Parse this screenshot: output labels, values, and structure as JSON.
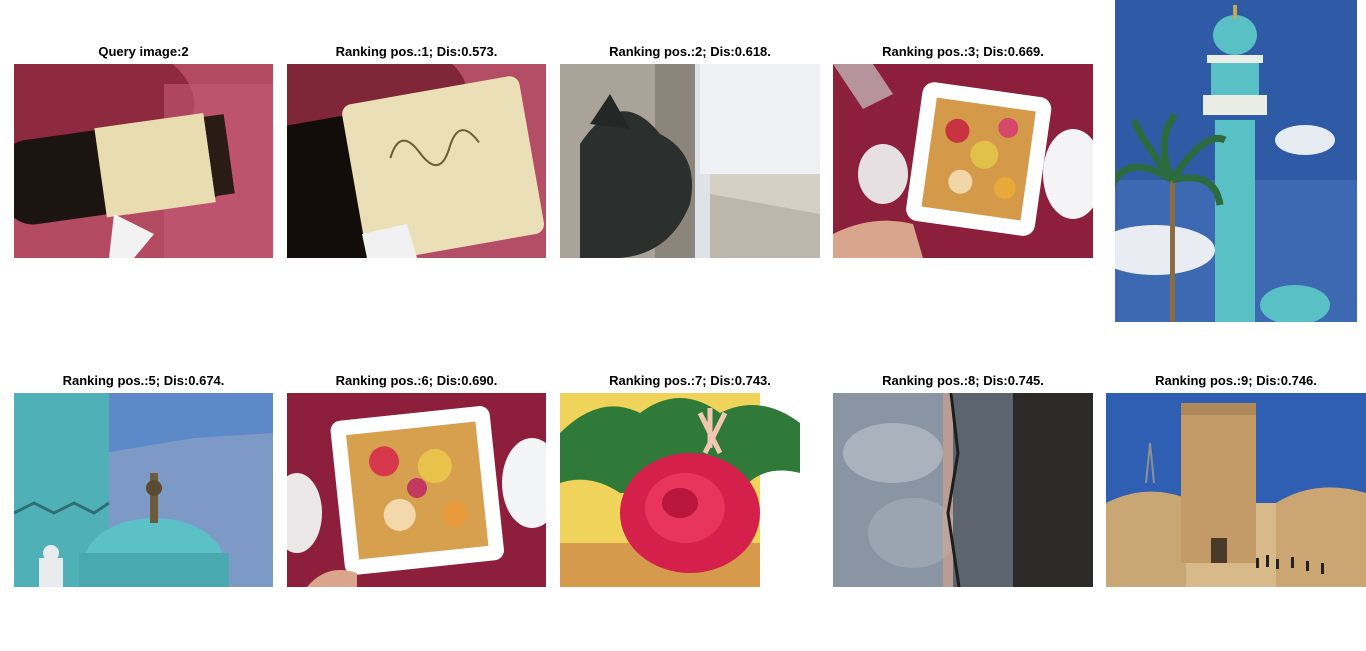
{
  "figure": {
    "cells": [
      {
        "title": "Query image:2",
        "subject": "wine bottle on red tablecloth"
      },
      {
        "title": "Ranking pos.:1; Dis:0.573.",
        "subject": "wine bottle label close-up"
      },
      {
        "title": "Ranking pos.:2; Dis:0.618.",
        "subject": "dragon statue and building"
      },
      {
        "title": "Ranking pos.:3; Dis:0.669.",
        "subject": "fruit tart on plate"
      },
      {
        "title": "",
        "subject": "turquoise minaret with palm tree"
      },
      {
        "title": "Ranking pos.:5; Dis:0.674.",
        "subject": "turquoise mosque dome"
      },
      {
        "title": "Ranking pos.:6; Dis:0.690.",
        "subject": "fruit tart on square plate"
      },
      {
        "title": "Ranking pos.:7; Dis:0.743.",
        "subject": "red rose bouquet"
      },
      {
        "title": "Ranking pos.:8; Dis:0.745.",
        "subject": "seascape rotated"
      },
      {
        "title": "Ranking pos.:9; Dis:0.746.",
        "subject": "stone tower in desert"
      }
    ]
  }
}
